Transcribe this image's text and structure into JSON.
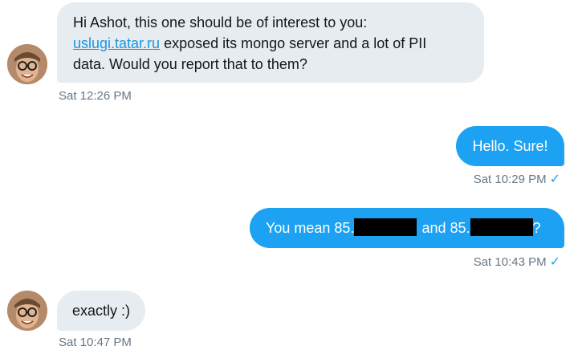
{
  "conversation": {
    "messages": [
      {
        "sender": "contact",
        "text_part1": "Hi Ashot, this one should be of interest to you:",
        "link": "uslugi.tatar.ru",
        "text_part2": " exposed its mongo server and a lot of PII",
        "text_part3": "data. Would you report that to them?",
        "timestamp": "Sat 12:26 PM"
      },
      {
        "sender": "me",
        "text": "Hello. Sure!",
        "timestamp": "Sat 10:29 PM",
        "read_icon": "checkmark-icon"
      },
      {
        "sender": "me",
        "text_part1": "You mean 85.",
        "text_part2": "and  85.",
        "text_part3": "?",
        "timestamp": "Sat 10:43 PM",
        "read_icon": "checkmark-icon"
      },
      {
        "sender": "contact",
        "text": "exactly :)",
        "timestamp": "Sat 10:47 PM"
      }
    ],
    "check_glyph": "✓"
  },
  "colors": {
    "incoming_bubble": "#e6ecf0",
    "outgoing_bubble": "#1da1f2",
    "link": "#1b95e0",
    "timestamp": "#657786",
    "redaction": "#000000"
  }
}
